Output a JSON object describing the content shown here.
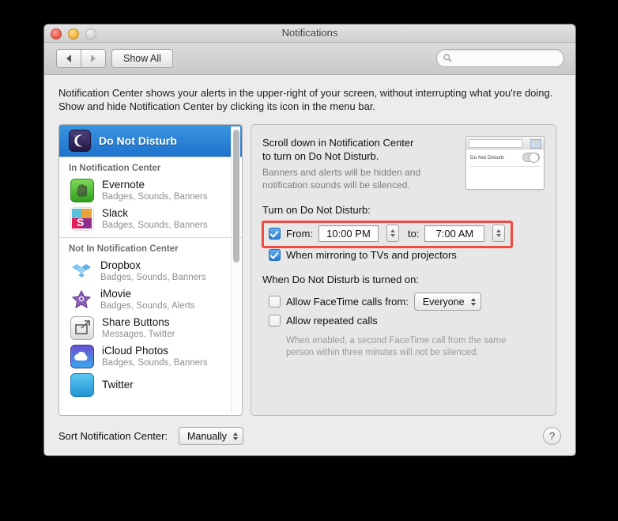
{
  "window": {
    "title": "Notifications",
    "traffic_lights": [
      "close-button",
      "minimize-button",
      "zoom-button"
    ]
  },
  "toolbar": {
    "back_label": "◀",
    "forward_label": "▶",
    "show_all_label": "Show All",
    "search_placeholder": "",
    "search_value": ""
  },
  "description": "Notification Center shows your alerts in the upper-right of your screen, without interrupting what you're doing. Show and hide Notification Center by clicking its icon in the menu bar.",
  "sidebar": {
    "selected": {
      "label": "Do Not Disturb",
      "icon": "moon-icon"
    },
    "groups": [
      {
        "header": "In Notification Center",
        "items": [
          {
            "name": "Evernote",
            "sub": "Badges, Sounds, Banners",
            "icon": "evernote-icon"
          },
          {
            "name": "Slack",
            "sub": "Badges, Sounds, Banners",
            "icon": "slack-icon"
          }
        ]
      },
      {
        "header": "Not In Notification Center",
        "items": [
          {
            "name": "Dropbox",
            "sub": "Badges, Sounds, Banners",
            "icon": "dropbox-icon"
          },
          {
            "name": "iMovie",
            "sub": "Badges, Sounds, Alerts",
            "icon": "imovie-icon"
          },
          {
            "name": "Share Buttons",
            "sub": "Messages, Twitter",
            "icon": "share-buttons-icon"
          },
          {
            "name": "iCloud Photos",
            "sub": "Badges, Sounds, Banners",
            "icon": "icloud-photos-icon"
          },
          {
            "name": "Twitter",
            "sub": "",
            "icon": "twitter-icon"
          }
        ]
      }
    ]
  },
  "panel": {
    "headline_line1": "Scroll down in Notification Center",
    "headline_line2": "to turn on Do Not Disturb.",
    "subtext_line1": "Banners and alerts will be hidden and",
    "subtext_line2": "notification sounds will be silenced.",
    "preview": {
      "label": "Do Not Disturb",
      "toggle_state": "off"
    },
    "turn_on_header": "Turn on Do Not Disturb:",
    "schedule": {
      "checked": true,
      "from_label": "From:",
      "from_value": "10:00 PM",
      "to_label": "to:",
      "to_value": "7:00 AM"
    },
    "mirroring": {
      "checked": true,
      "label": "When mirroring to TVs and projectors"
    },
    "when_on_header": "When Do Not Disturb is turned on:",
    "facetime": {
      "checked": false,
      "label": "Allow FaceTime calls from:",
      "popup_value": "Everyone"
    },
    "repeated": {
      "checked": false,
      "label": "Allow repeated calls"
    },
    "hint_line1": "When enabled, a second FaceTime call from the same",
    "hint_line2": "person within three minutes will not be silenced."
  },
  "bottom": {
    "sort_label": "Sort Notification Center:",
    "sort_value": "Manually",
    "help_label": "?"
  },
  "colors": {
    "selection_blue": "#2a7fd6",
    "annotation_red": "#f04a42",
    "window_bg": "#ececec",
    "panel_bg": "#e7e7e7"
  }
}
